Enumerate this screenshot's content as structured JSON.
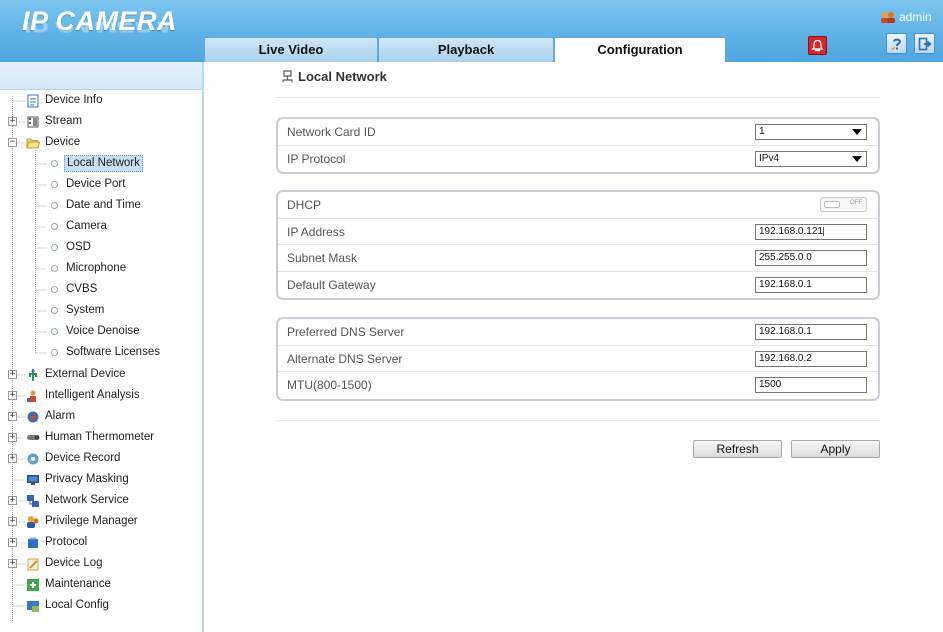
{
  "header": {
    "logo": "IP CAMERA",
    "user": "admin",
    "tabs": [
      {
        "label": "Live Video",
        "active": false
      },
      {
        "label": "Playback",
        "active": false
      },
      {
        "label": "Configuration",
        "active": true
      }
    ],
    "alarm_icon": "alarm-bell-icon",
    "buttons": [
      "help-icon",
      "logout-icon"
    ]
  },
  "sidebar": {
    "items": [
      {
        "label": "Device Info",
        "icon": "document-icon"
      },
      {
        "label": "Stream",
        "icon": "film-icon",
        "expandable": true
      },
      {
        "label": "Device",
        "icon": "folder-icon",
        "expanded": true
      },
      {
        "label": "Local Network",
        "selected": true
      },
      {
        "label": "Device Port"
      },
      {
        "label": "Date and Time"
      },
      {
        "label": "Camera"
      },
      {
        "label": "OSD"
      },
      {
        "label": "Microphone"
      },
      {
        "label": "CVBS"
      },
      {
        "label": "System"
      },
      {
        "label": "Voice Denoise"
      },
      {
        "label": "Software Licenses"
      },
      {
        "label": "External Device",
        "icon": "plug-icon",
        "expandable": true
      },
      {
        "label": "Intelligent Analysis",
        "icon": "analysis-icon",
        "expandable": true
      },
      {
        "label": "Alarm",
        "icon": "alarm-icon",
        "expandable": true
      },
      {
        "label": "Human Thermometer",
        "icon": "thermometer-icon",
        "expandable": true
      },
      {
        "label": "Device Record",
        "icon": "record-icon",
        "expandable": true
      },
      {
        "label": "Privacy Masking",
        "icon": "monitor-icon"
      },
      {
        "label": "Network Service",
        "icon": "network-icon",
        "expandable": true
      },
      {
        "label": "Privilege Manager",
        "icon": "users-icon",
        "expandable": true
      },
      {
        "label": "Protocol",
        "icon": "protocol-icon",
        "expandable": true
      },
      {
        "label": "Device Log",
        "icon": "log-icon",
        "expandable": true
      },
      {
        "label": "Maintenance",
        "icon": "maintenance-icon"
      },
      {
        "label": "Local Config",
        "icon": "local-config-icon"
      }
    ]
  },
  "main": {
    "title": "Local Network",
    "title_icon": "network-card-icon",
    "groups": [
      {
        "rows": [
          {
            "label": "Network Card ID",
            "type": "select",
            "value": "1"
          },
          {
            "label": "IP Protocol",
            "type": "select",
            "value": "IPv4"
          }
        ]
      },
      {
        "rows": [
          {
            "label": "DHCP",
            "type": "toggle",
            "value": "OFF"
          },
          {
            "label": "IP Address",
            "type": "input",
            "value": "192.168.0.121"
          },
          {
            "label": "Subnet Mask",
            "type": "input",
            "value": "255.255.0.0"
          },
          {
            "label": "Default Gateway",
            "type": "input",
            "value": "192.168.0.1"
          }
        ]
      },
      {
        "rows": [
          {
            "label": "Preferred DNS Server",
            "type": "input",
            "value": "192.168.0.1"
          },
          {
            "label": "Alternate DNS Server",
            "type": "input",
            "value": "192.168.0.2"
          },
          {
            "label": "MTU(800-1500)",
            "type": "input",
            "value": "1500"
          }
        ]
      }
    ],
    "buttons": {
      "refresh": "Refresh",
      "apply": "Apply"
    }
  }
}
